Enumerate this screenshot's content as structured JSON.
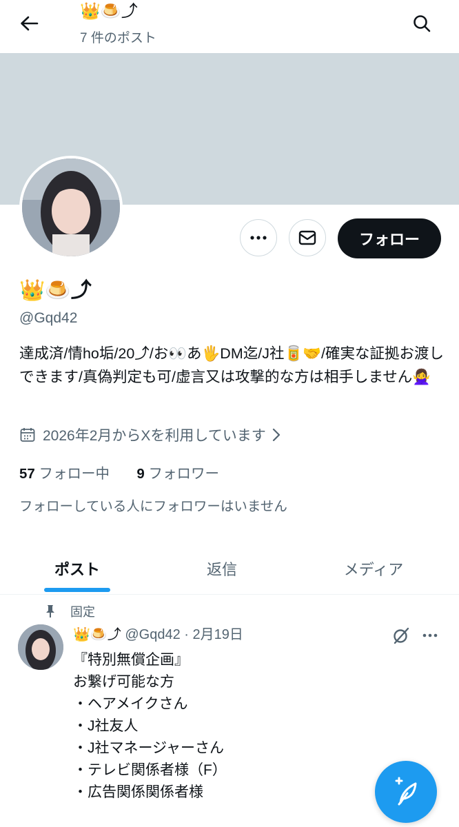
{
  "header": {
    "display_name": "👑🍮⤴",
    "post_count": "7 件のポスト"
  },
  "profile": {
    "display_name": "👑🍮⤴",
    "handle": "@Gqd42",
    "follow_label": "フォロー",
    "bio": "達成済/情ho垢/20⤴/お👀あ🖐DM迄/J社🥫🤝/確実な証拠お渡しできます/真偽判定も可/虚言又は攻撃的な方は相手しません🙅‍♀️",
    "joined": "2026年2月からXを利用しています",
    "following_count": "57",
    "following_label": "フォロー中",
    "followers_count": "9",
    "followers_label": "フォロワー",
    "mutual_note": "フォローしている人にフォロワーはいません"
  },
  "tabs": [
    {
      "label": "ポスト"
    },
    {
      "label": "返信"
    },
    {
      "label": "メディア"
    }
  ],
  "pinned_post": {
    "pinned_label": "固定",
    "author_name": "👑🍮⤴",
    "handle": "@Gqd42",
    "separator": "·",
    "date": "2月19日",
    "lines": [
      "『特別無償企画』",
      "お繋げ可能な方",
      "・ヘアメイクさん",
      "・J社友人",
      "・J社マネージャーさん",
      "・テレビ関係者様（F）",
      "・広告関係関係者様"
    ]
  },
  "colors": {
    "accent": "#1d9bf0",
    "text_primary": "#0f1419",
    "text_secondary": "#536471",
    "banner": "#cfd9de"
  },
  "icons": [
    "back-arrow-icon",
    "search-icon",
    "more-icon",
    "mail-icon",
    "calendar-icon",
    "chevron-right-icon",
    "pin-icon",
    "grok-icon",
    "compose-icon"
  ]
}
